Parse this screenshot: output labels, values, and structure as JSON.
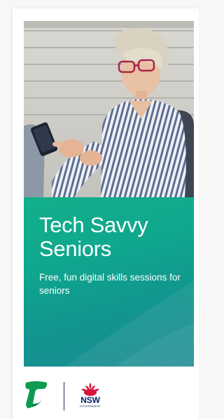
{
  "brochure": {
    "title": "Tech Savvy Seniors",
    "subtitle": "Free, fun digital skills sessions for seniors"
  },
  "logos": {
    "telstra": {
      "icon": "telstra-t-icon",
      "color": "#0d9b4f"
    },
    "nsw": {
      "icon": "waratah-icon",
      "text": "NSW",
      "subtext": "GOVERNMENT",
      "color": "#d7153a",
      "text_color": "#002664"
    }
  },
  "colors": {
    "panel_start": "#13b08b",
    "panel_end": "#1b8a94"
  }
}
